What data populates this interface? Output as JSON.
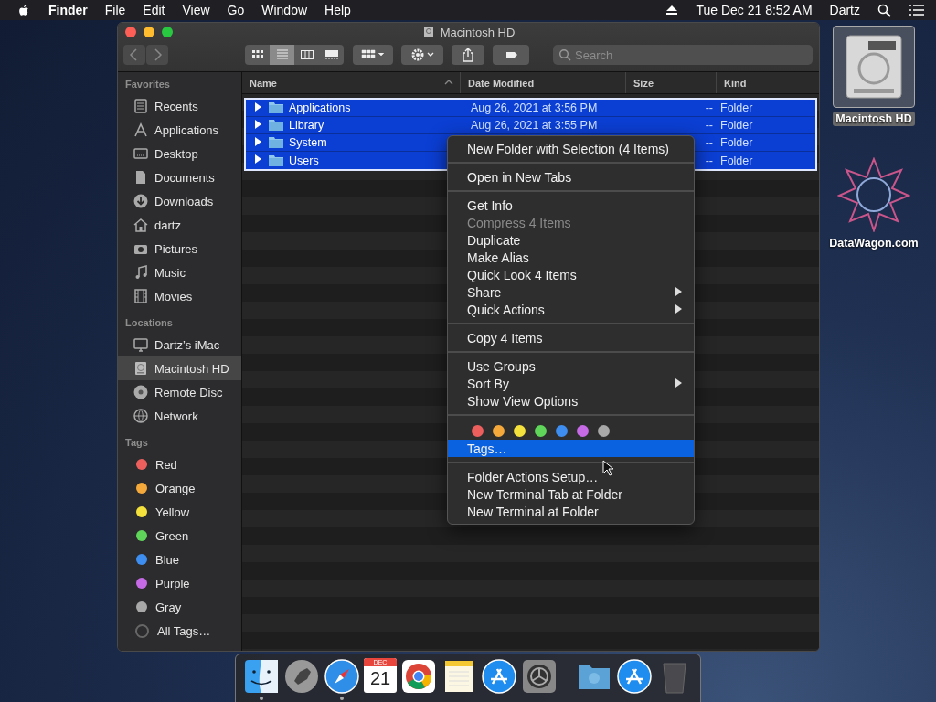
{
  "menu_bar": {
    "app": "Finder",
    "menus": [
      "File",
      "Edit",
      "View",
      "Go",
      "Window",
      "Help"
    ],
    "clock": "Tue Dec 21  8:52 AM",
    "user": "Dartz"
  },
  "window": {
    "title": "Macintosh HD",
    "view_modes": [
      {
        "selected": false
      },
      {
        "selected": true
      },
      {
        "selected": false
      },
      {
        "selected": false
      }
    ],
    "search": {
      "placeholder": "Search"
    }
  },
  "sidebar": {
    "sections": [
      {
        "kind": "favorites",
        "title": "Favorites",
        "items": [
          {
            "label": "Recents",
            "selected": false
          },
          {
            "label": "Applications",
            "selected": false
          },
          {
            "label": "Desktop",
            "selected": false
          },
          {
            "label": "Documents",
            "selected": false
          },
          {
            "label": "Downloads",
            "selected": false
          },
          {
            "label": "dartz",
            "selected": false
          },
          {
            "label": "Pictures",
            "selected": false
          },
          {
            "label": "Music",
            "selected": false
          },
          {
            "label": "Movies",
            "selected": false
          }
        ]
      },
      {
        "kind": "locations",
        "title": "Locations",
        "items": [
          {
            "label": "Dartz’s iMac",
            "selected": false
          },
          {
            "label": "Macintosh HD",
            "selected": true
          },
          {
            "label": "Remote Disc",
            "selected": false
          },
          {
            "label": "Network",
            "selected": false
          }
        ]
      },
      {
        "kind": "tags",
        "title": "Tags",
        "items": [
          {
            "label": "Red",
            "selected": false,
            "color": "#ec5f5c"
          },
          {
            "label": "Orange",
            "selected": false,
            "color": "#f4a93a"
          },
          {
            "label": "Yellow",
            "selected": false,
            "color": "#f5e13c"
          },
          {
            "label": "Green",
            "selected": false,
            "color": "#5fd65a"
          },
          {
            "label": "Blue",
            "selected": false,
            "color": "#3d8ef0"
          },
          {
            "label": "Purple",
            "selected": false,
            "color": "#c66ae6"
          },
          {
            "label": "Gray",
            "selected": false,
            "color": "#a8a8a8"
          },
          {
            "label": "All Tags…",
            "selected": false
          }
        ]
      }
    ]
  },
  "table": {
    "columns": [
      {
        "label": "Name",
        "sorted": true
      },
      {
        "label": "Date Modified",
        "sorted": false
      },
      {
        "label": "Size",
        "sorted": false
      },
      {
        "label": "Kind",
        "sorted": false
      }
    ],
    "rows": [
      {
        "name": "Applications",
        "date": "Aug 26, 2021 at 3:56 PM",
        "size": "--",
        "kind": "Folder",
        "selected": true,
        "expanded": false
      },
      {
        "name": "Library",
        "date": "Aug 26, 2021 at 3:55 PM",
        "size": "--",
        "kind": "Folder",
        "selected": true,
        "expanded": false
      },
      {
        "name": "System",
        "size": "--",
        "kind": "Folder",
        "selected": true,
        "expanded": false
      },
      {
        "name": "Users",
        "size": "--",
        "kind": "Folder",
        "selected": true,
        "expanded": false
      }
    ]
  },
  "context_menu": {
    "sections": [
      {
        "kind": "items",
        "items": [
          {
            "label": "New Folder with Selection (4 Items)",
            "disabled": false,
            "submenu": false,
            "highlighted": false
          }
        ]
      },
      {
        "kind": "items",
        "items": [
          {
            "label": "Open in New Tabs",
            "disabled": false,
            "submenu": false,
            "highlighted": false
          }
        ]
      },
      {
        "kind": "items",
        "items": [
          {
            "label": "Get Info",
            "disabled": false,
            "submenu": false,
            "highlighted": false
          },
          {
            "label": "Compress 4 Items",
            "disabled": true,
            "submenu": false,
            "highlighted": false
          },
          {
            "label": "Duplicate",
            "disabled": false,
            "submenu": false,
            "highlighted": false
          },
          {
            "label": "Make Alias",
            "disabled": false,
            "submenu": false,
            "highlighted": false
          },
          {
            "label": "Quick Look 4 Items",
            "disabled": false,
            "submenu": false,
            "highlighted": false
          },
          {
            "label": "Share",
            "disabled": false,
            "submenu": true,
            "highlighted": false
          },
          {
            "label": "Quick Actions",
            "disabled": false,
            "submenu": true,
            "highlighted": false
          }
        ]
      },
      {
        "kind": "items",
        "items": [
          {
            "label": "Copy 4 Items",
            "disabled": false,
            "submenu": false,
            "highlighted": false
          }
        ]
      },
      {
        "kind": "items",
        "items": [
          {
            "label": "Use Groups",
            "disabled": false,
            "submenu": false,
            "highlighted": false
          },
          {
            "label": "Sort By",
            "disabled": false,
            "submenu": true,
            "highlighted": false
          },
          {
            "label": "Show View Options",
            "disabled": false,
            "submenu": false,
            "highlighted": false
          }
        ]
      },
      {
        "kind": "tags",
        "colors": [
          {
            "color": "#ec5f5c"
          },
          {
            "color": "#f4a93a"
          },
          {
            "color": "#f5e13c"
          },
          {
            "color": "#5fd65a"
          },
          {
            "color": "#3d8ef0"
          },
          {
            "color": "#c66ae6"
          },
          {
            "color": "#a8a8a8"
          }
        ],
        "items": [
          {
            "label": "Tags…",
            "disabled": false,
            "submenu": false,
            "highlighted": true
          }
        ]
      },
      {
        "kind": "items",
        "items": [
          {
            "label": "Folder Actions Setup…",
            "disabled": false,
            "submenu": false,
            "highlighted": false
          },
          {
            "label": "New Terminal Tab at Folder",
            "disabled": false,
            "submenu": false,
            "highlighted": false
          },
          {
            "label": "New Terminal at Folder",
            "disabled": false,
            "submenu": false,
            "highlighted": false
          }
        ]
      }
    ]
  },
  "desktop": {
    "icons": [
      {
        "label": "Macintosh HD",
        "selected": true
      },
      {
        "label": "DataWagon.com",
        "selected": false
      }
    ]
  },
  "dock": {
    "calendar": {
      "month": "DEC",
      "day": "21"
    },
    "apps": [
      {
        "running": true
      },
      {
        "running": false
      },
      {
        "running": true
      },
      {
        "running": false
      },
      {
        "running": false
      },
      {
        "running": false
      },
      {
        "running": false
      },
      {
        "running": false
      }
    ]
  }
}
